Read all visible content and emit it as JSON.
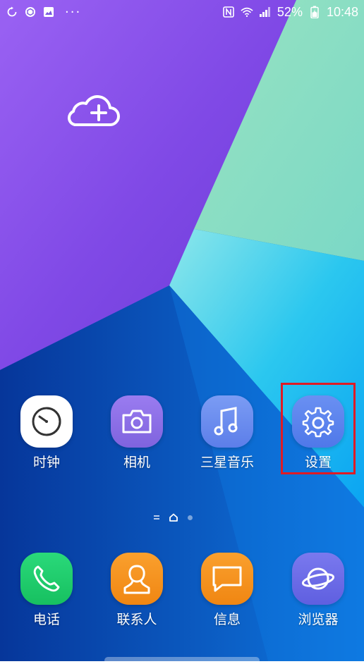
{
  "status_bar": {
    "battery_percent": "52%",
    "time": "10:48",
    "left_icons": [
      "refresh-icon",
      "hexagon-app-icon",
      "gallery-icon",
      "more-dots-icon"
    ],
    "right_icons": [
      "nfc-icon",
      "wifi-icon",
      "signal-icon",
      "battery-icon"
    ],
    "more_dots": "···"
  },
  "widget": {
    "icon": "cloud-add-icon"
  },
  "home_apps": [
    {
      "label": "时钟",
      "icon": "clock-icon",
      "bg": "#ffffff"
    },
    {
      "label": "相机",
      "icon": "camera-icon",
      "bg": "#8e72e6"
    },
    {
      "label": "三星音乐",
      "icon": "music-icon",
      "bg": "#6b8cf2"
    },
    {
      "label": "设置",
      "icon": "gear-icon",
      "bg": "#5b83ef"
    }
  ],
  "dock_apps": [
    {
      "label": "电话",
      "icon": "phone-icon",
      "bg": "#1fcf6c"
    },
    {
      "label": "联系人",
      "icon": "contact-icon",
      "bg": "#f7931e"
    },
    {
      "label": "信息",
      "icon": "message-icon",
      "bg": "#f7931e"
    },
    {
      "label": "浏览器",
      "icon": "browser-icon",
      "bg": "#6e6de6"
    }
  ],
  "colors": {
    "highlight": "#e01b24"
  }
}
